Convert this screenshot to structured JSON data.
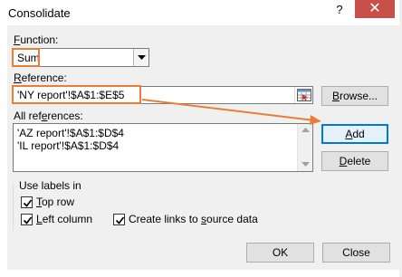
{
  "window": {
    "title": "Consolidate"
  },
  "titlebar": {
    "help": "?",
    "close": "✕"
  },
  "function": {
    "label_accel": "F",
    "label_rest": "unction:",
    "selected": "Sum"
  },
  "reference": {
    "label_accel": "R",
    "label_rest": "eference:",
    "value": "'NY report'!$A$1:$E$5"
  },
  "all_references": {
    "label_pre": "All ref",
    "label_accel": "e",
    "label_rest": "rences:",
    "items": [
      "'AZ report'!$A$1:$D$4",
      "'IL report'!$A$1:$D$4"
    ]
  },
  "buttons": {
    "browse_accel": "B",
    "browse_rest": "rowse...",
    "add_accel": "A",
    "add_rest": "dd",
    "delete_accel": "D",
    "delete_rest": "elete",
    "ok": "OK",
    "close": "Close"
  },
  "labels_group": {
    "title": "Use labels in",
    "top_row_accel": "T",
    "top_row_rest": "op row",
    "left_column_accel": "L",
    "left_column_rest": "eft column"
  },
  "create_links": {
    "pre": "Create links to ",
    "accel": "s",
    "rest": "ource data"
  },
  "annotation_color": "#ec7c3a",
  "checkboxes": {
    "top_row": true,
    "left_column": true,
    "create_links": true
  }
}
